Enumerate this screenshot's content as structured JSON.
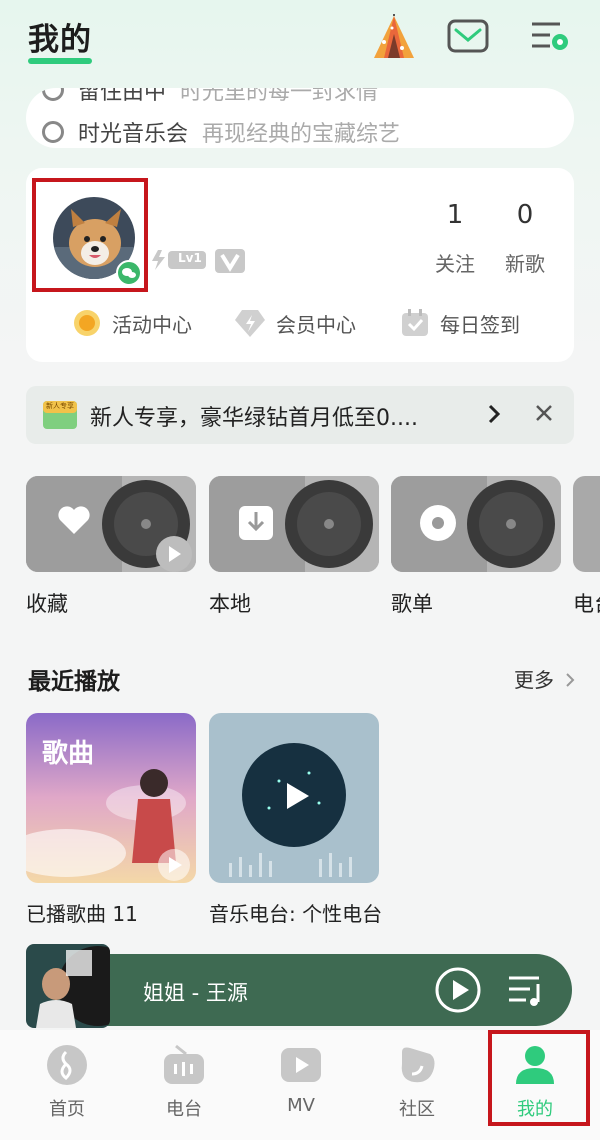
{
  "header": {
    "title": "我的"
  },
  "search": {
    "line1_main": "留住由中",
    "line1_sub": "时光里的每一封求情",
    "line2_main": "时光音乐会",
    "line2_sub": "再现经典的宝藏综艺"
  },
  "profile": {
    "level": "Lv1",
    "following_count": "1",
    "following_label": "关注",
    "new_songs_count": "0",
    "new_songs_label": "新歌",
    "quick_links": [
      "活动中心",
      "会员中心",
      "每日签到"
    ]
  },
  "banner": {
    "badge": "新人专享",
    "text": "新人专享，豪华绿钻首月低至0...."
  },
  "categories": [
    "收藏",
    "本地",
    "歌单",
    "电台"
  ],
  "recent": {
    "title": "最近播放",
    "more_label": "更多",
    "items": [
      {
        "overlay": "歌曲",
        "label": "已播歌曲 11"
      },
      {
        "label": "音乐电台: 个性电台"
      }
    ]
  },
  "player": {
    "song": "姐姐 - 王源"
  },
  "nav": [
    "首页",
    "电台",
    "MV",
    "社区",
    "我的"
  ],
  "colors": {
    "accent": "#2fcb7d",
    "highlight_frame": "#c6161c",
    "player_bg": "#3e6a52"
  }
}
